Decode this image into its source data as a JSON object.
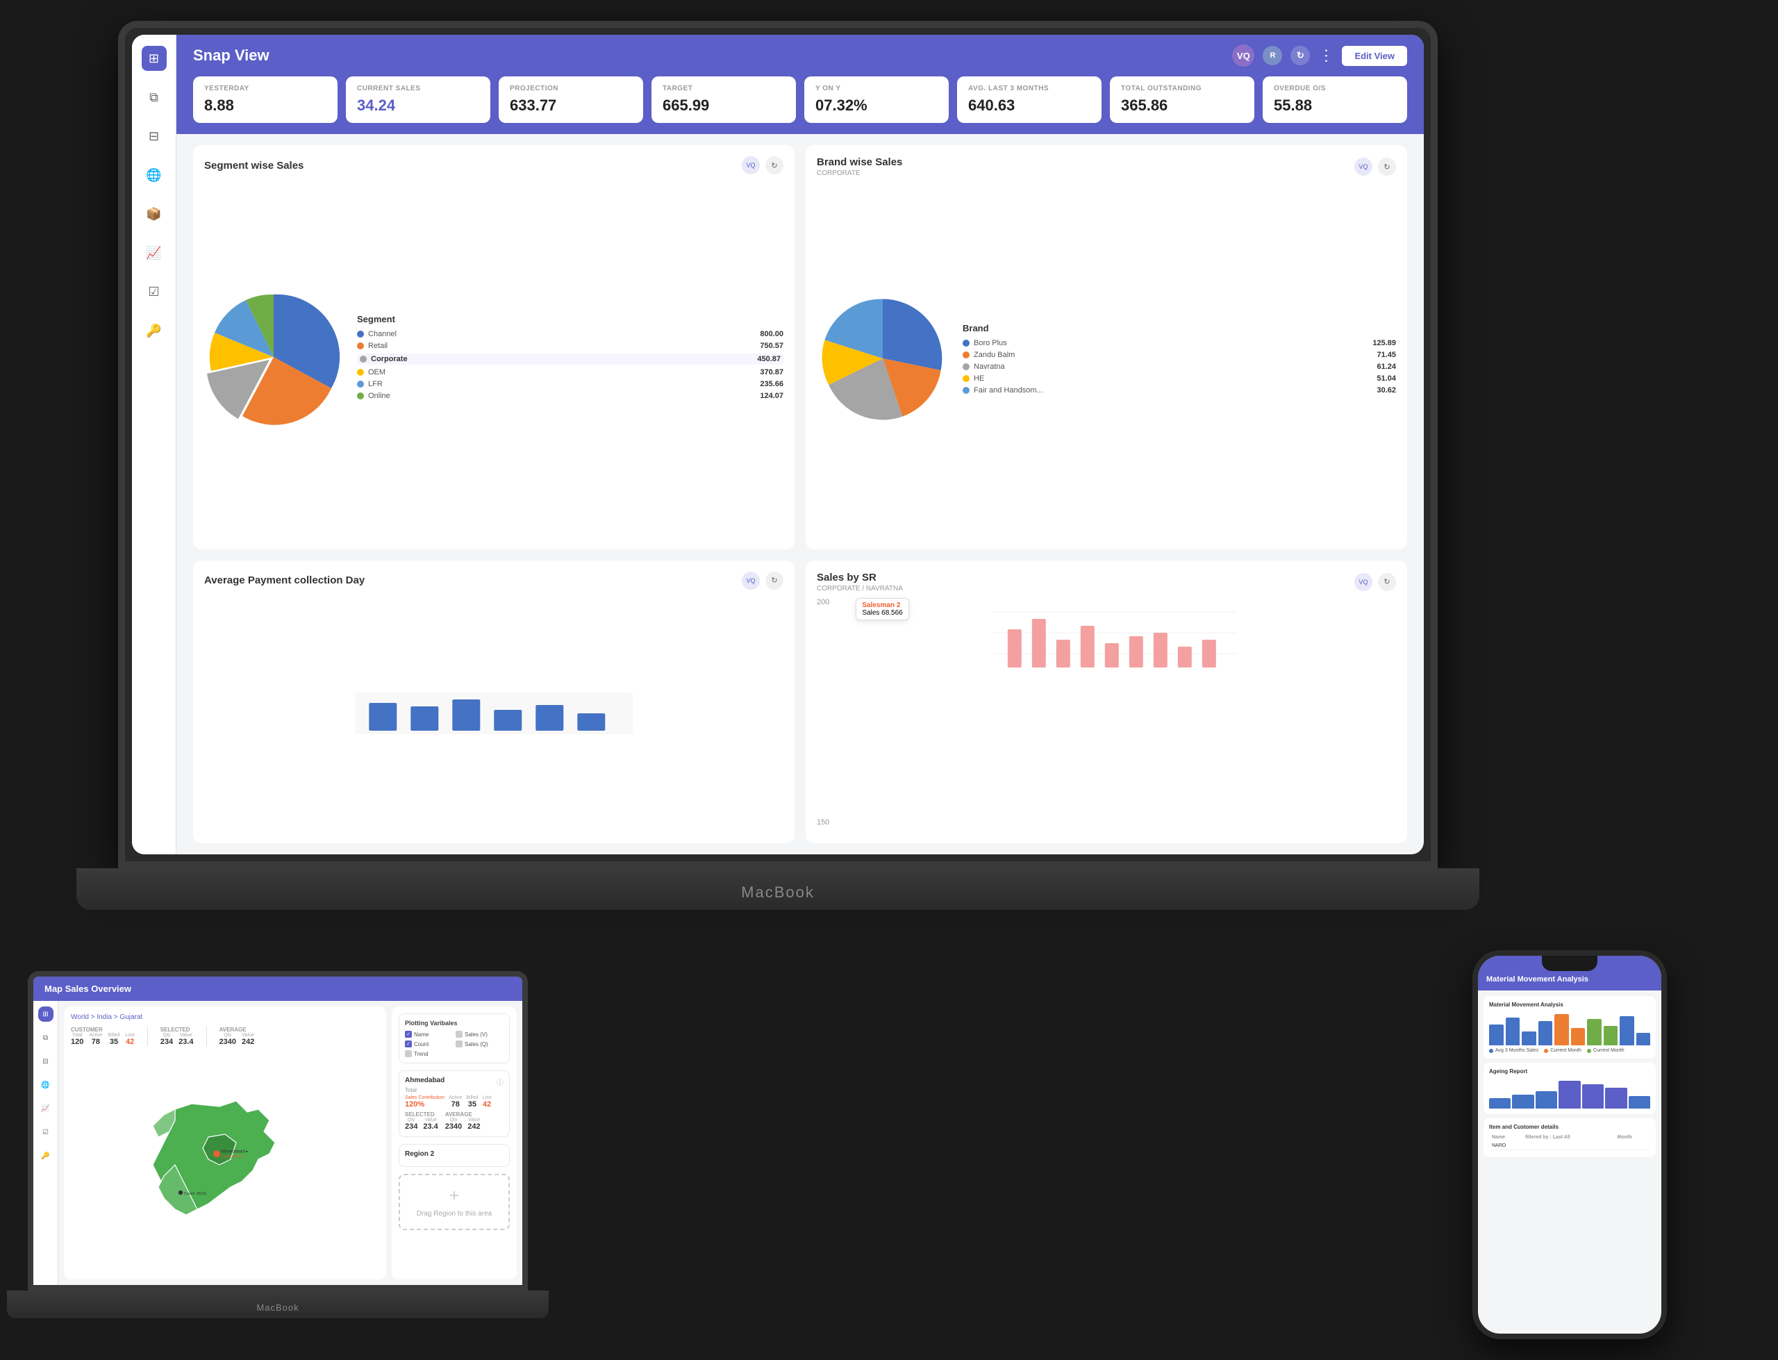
{
  "app": {
    "title": "Snap View",
    "edit_view_label": "Edit View",
    "header_avatar1": "VQ",
    "header_avatar2": "R"
  },
  "kpis": [
    {
      "label": "YESTERDAY",
      "value": "8.88"
    },
    {
      "label": "CURRENT SALES",
      "value": "34.24"
    },
    {
      "label": "PROJECTION",
      "value": "633.77"
    },
    {
      "label": "TARGET",
      "value": "665.99"
    },
    {
      "label": "Y ON Y",
      "value": "07.32%"
    },
    {
      "label": "AVG. LAST 3 MONTHS",
      "value": "640.63"
    },
    {
      "label": "TOTAL OUTSTANDING",
      "value": "365.86"
    },
    {
      "label": "OVERDUE O/S",
      "value": "55.88"
    }
  ],
  "segment_chart": {
    "title": "Segment wise Sales",
    "legend_title": "Segment",
    "items": [
      {
        "name": "Channel",
        "value": "800.00",
        "color": "#4472C4"
      },
      {
        "name": "Retail",
        "value": "750.57",
        "color": "#ED7D31"
      },
      {
        "name": "Corporate",
        "value": "450.87",
        "color": "#A5A5A5",
        "selected": true
      },
      {
        "name": "OEM",
        "value": "370.87",
        "color": "#FFC000"
      },
      {
        "name": "LFR",
        "value": "235.66",
        "color": "#5B9BD5"
      },
      {
        "name": "Online",
        "value": "124.07",
        "color": "#70AD47"
      }
    ]
  },
  "brand_chart": {
    "title": "Brand wise Sales",
    "subtitle": "CORPORATE",
    "legend_title": "Brand",
    "items": [
      {
        "name": "Boro Plus",
        "value": "125.89",
        "color": "#4472C4"
      },
      {
        "name": "Zandu Balm",
        "value": "71.45",
        "color": "#ED7D31"
      },
      {
        "name": "Navratna",
        "value": "61.24",
        "color": "#A5A5A5"
      },
      {
        "name": "HE",
        "value": "51.04",
        "color": "#FFC000"
      },
      {
        "name": "Fair and Handsom...",
        "value": "30.62",
        "color": "#5B9BD5"
      }
    ]
  },
  "sales_sr": {
    "title": "Sales by SR",
    "subtitle": "CORPORATE / NAVRATNA",
    "tooltip_salesman": "Salesman 2",
    "tooltip_sales": "Sales  68.566",
    "y_labels": [
      "200",
      "150"
    ]
  },
  "map_app": {
    "title": "Map Sales Overview",
    "breadcrumb": "World > India > Gujarat",
    "customer_label": "Customer",
    "selected_label": "Selected",
    "average_label": "Average",
    "stats": {
      "total": "120",
      "active": "78",
      "billed": "35",
      "lost": "42",
      "selected_qty": "234",
      "selected_value": "23.4",
      "avg_qty": "2340",
      "avg_value": "242"
    },
    "plotting_title": "Plotting Varibales",
    "checks": [
      "Name",
      "Count",
      "Trend",
      "Sales (V)",
      "Sales (Q)"
    ],
    "region_ahmedabad": {
      "name": "Ahmedabad",
      "total": "Total",
      "active": "78",
      "billed": "35",
      "lost": "42",
      "sales_contribution": "120%",
      "selected_qty": "234",
      "selected_value": "23.4",
      "avg_qty": "2340",
      "avg_value": "242"
    },
    "region2_name": "Region 2",
    "drag_text": "Drag Region to this area"
  },
  "phone_app": {
    "title": "Material Movement Analysis",
    "ageing_title": "Ageing Report",
    "item_customer_title": "Item and Customer details",
    "table_headers": [
      "Name",
      "filtered by : Last All",
      "Month"
    ],
    "table_row": [
      "NARO",
      "",
      ""
    ],
    "bar_colors": {
      "primary": "#4472C4",
      "secondary": "#ED7D31",
      "tertiary": "#70AD47"
    },
    "legend_items": [
      {
        "label": "Avg 3 Months Sales",
        "color": "#4472C4"
      },
      {
        "label": "Current Month",
        "color": "#ED7D31"
      },
      {
        "label": "Current Month",
        "color": "#70AD47"
      }
    ]
  },
  "sidebar_icons": [
    "grid",
    "copy",
    "layers",
    "globe",
    "box",
    "chart",
    "list-check",
    "key"
  ],
  "colors": {
    "brand": "#5b5fc7",
    "orange": "#ED7D31",
    "green": "#70AD47",
    "yellow": "#FFC000",
    "blue": "#4472C4",
    "gray": "#A5A5A5",
    "light_blue": "#5B9BD5"
  }
}
